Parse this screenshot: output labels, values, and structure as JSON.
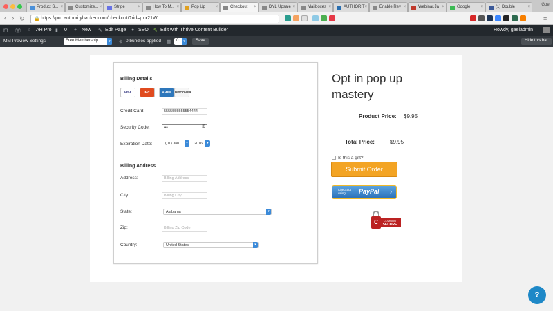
{
  "browser": {
    "tabs": [
      {
        "label": "Product S...",
        "color": "#4a90d9"
      },
      {
        "label": "Customize...",
        "color": "#888888"
      },
      {
        "label": "Stripe",
        "color": "#6772e5"
      },
      {
        "label": "How To M...",
        "color": "#888888"
      },
      {
        "label": "Pop Up",
        "color": "#e0a020"
      },
      {
        "label": "Checkout",
        "color": "#888888"
      },
      {
        "label": "DYL Upsale",
        "color": "#888888"
      },
      {
        "label": "Mailboxes",
        "color": "#888888"
      },
      {
        "label": "AUTHORIT",
        "color": "#2a6fb0"
      },
      {
        "label": "Enable Rev",
        "color": "#888888"
      },
      {
        "label": "Webinar.Ja",
        "color": "#c0392b"
      },
      {
        "label": "Google",
        "color": "#3cba54"
      },
      {
        "label": "(1) Double",
        "color": "#3b5998"
      }
    ],
    "profile": "Goel",
    "url": "https://pro.authorityhacker.com/checkout/?rid=pxx21W"
  },
  "adminbar": {
    "site": "AH Pro",
    "comments": "0",
    "new": "New",
    "edit_page": "Edit Page",
    "seo": "SEO",
    "thrive": "Edit with Thrive Content Builder",
    "howdy": "Howdy, gaeladmin"
  },
  "mmbar": {
    "label": "MM Preview Settings",
    "membership": "Free Membership",
    "bundles": "0  bundles applied",
    "count": "0",
    "save": "Save",
    "hide": "Hide this bar"
  },
  "billing": {
    "title": "Billing Details",
    "cards": [
      "VISA",
      "MC",
      "AMEX",
      "DISCOVER"
    ],
    "credit_card_label": "Credit Card:",
    "credit_card_value": "5555555555554444",
    "security_label": "Security Code:",
    "security_value": "•••",
    "expiration_label": "Expiration Date:",
    "exp_month": "(01) Jan",
    "exp_year": "2016",
    "address_title": "Billing Address",
    "address_label": "Address:",
    "address_placeholder": "Billing Address",
    "city_label": "City:",
    "city_placeholder": "Billing City",
    "state_label": "State:",
    "state_value": "Alabama",
    "zip_label": "Zip:",
    "zip_placeholder": "Billing Zip Code",
    "country_label": "Country:",
    "country_value": "United States"
  },
  "summary": {
    "title": "Opt in pop up mastery",
    "product_price_label": "Product Price:",
    "product_price": "$9.95",
    "total_price_label": "Total Price:",
    "total_price": "$9.95",
    "gift_label": "Is this a gift?",
    "submit": "Submit Order",
    "paypal_small": "Checkout using",
    "paypal_brand": "PayPal",
    "seal_brand": "COMODO",
    "seal_text": "SECURE"
  },
  "help_icon": "?"
}
